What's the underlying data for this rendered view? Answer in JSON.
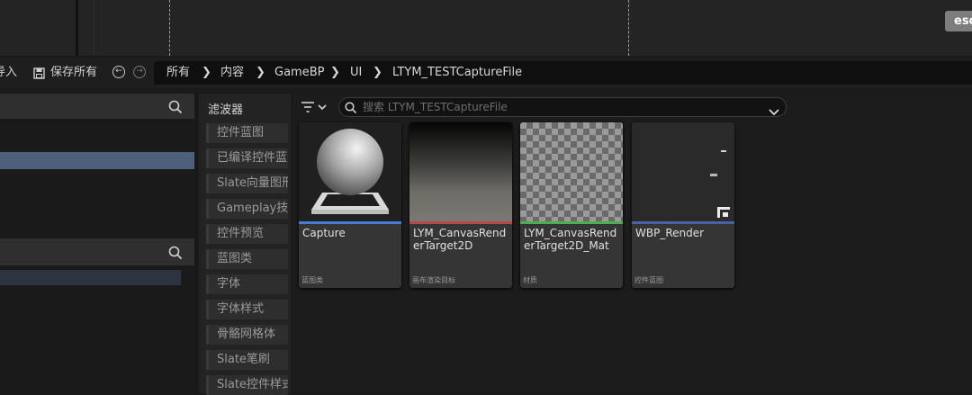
{
  "viewport": {
    "esc_label": "esc"
  },
  "toolbar": {
    "import_label": "导入",
    "save_all_label": "保存所有"
  },
  "breadcrumb": [
    "所有",
    "内容",
    "GameBP",
    "UI",
    "LTYM_TESTCaptureFile"
  ],
  "filters": {
    "title": "滤波器",
    "items": [
      "控件蓝图",
      "已编译控件蓝图",
      "Slate向量图形",
      "Gameplay技能",
      "控件预览",
      "蓝图类",
      "字体",
      "字体样式",
      "骨骼网格体",
      "Slate笔刷",
      "Slate控件样式"
    ]
  },
  "search": {
    "placeholder": "搜索 LTYM_TESTCaptureFile"
  },
  "assets": [
    {
      "name": "Capture",
      "type": "蓝图类",
      "stripe_color": "#4a7bd8",
      "icon": "sphere-thumbnail"
    },
    {
      "name": "LYM_CanvasRenderTarget2D",
      "type": "画布渲染目标",
      "stripe_color": "#b84a4a",
      "icon": "render-target-thumbnail"
    },
    {
      "name": "LYM_CanvasRenderTarget2D_Mat",
      "type": "材质",
      "stripe_color": "#4cae4c",
      "icon": "checker-thumbnail"
    },
    {
      "name": "WBP_Render",
      "type": "控件蓝图",
      "stripe_color": "#4a5fa8",
      "icon": "widget-thumbnail"
    }
  ],
  "colors": {
    "accent_selection": "#4d5f7a",
    "background": "#1a1a1a"
  }
}
